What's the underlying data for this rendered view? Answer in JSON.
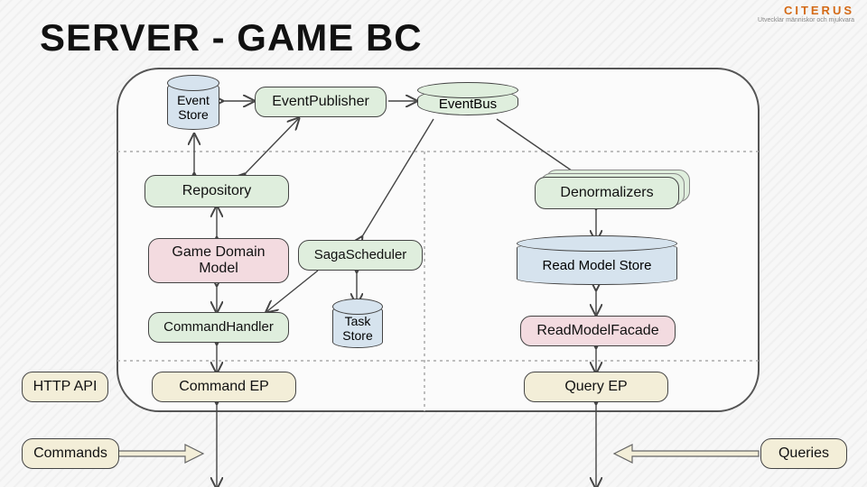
{
  "title": "SERVER - GAME BC",
  "logo": {
    "brand": "CITERUS",
    "tagline": "Utvecklar människor och mjukvara"
  },
  "nodes": {
    "event_store": "Event\nStore",
    "event_publisher": "EventPublisher",
    "event_bus": "EventBus",
    "repository": "Repository",
    "denormalizers": "Denormalizers",
    "game_domain_model": "Game Domain\nModel",
    "saga_scheduler": "SagaScheduler",
    "read_model_store": "Read Model Store",
    "command_handler": "CommandHandler",
    "task_store": "Task\nStore",
    "read_model_facade": "ReadModelFacade",
    "http_api": "HTTP API",
    "command_ep": "Command EP",
    "query_ep": "Query EP",
    "commands": "Commands",
    "queries": "Queries"
  }
}
